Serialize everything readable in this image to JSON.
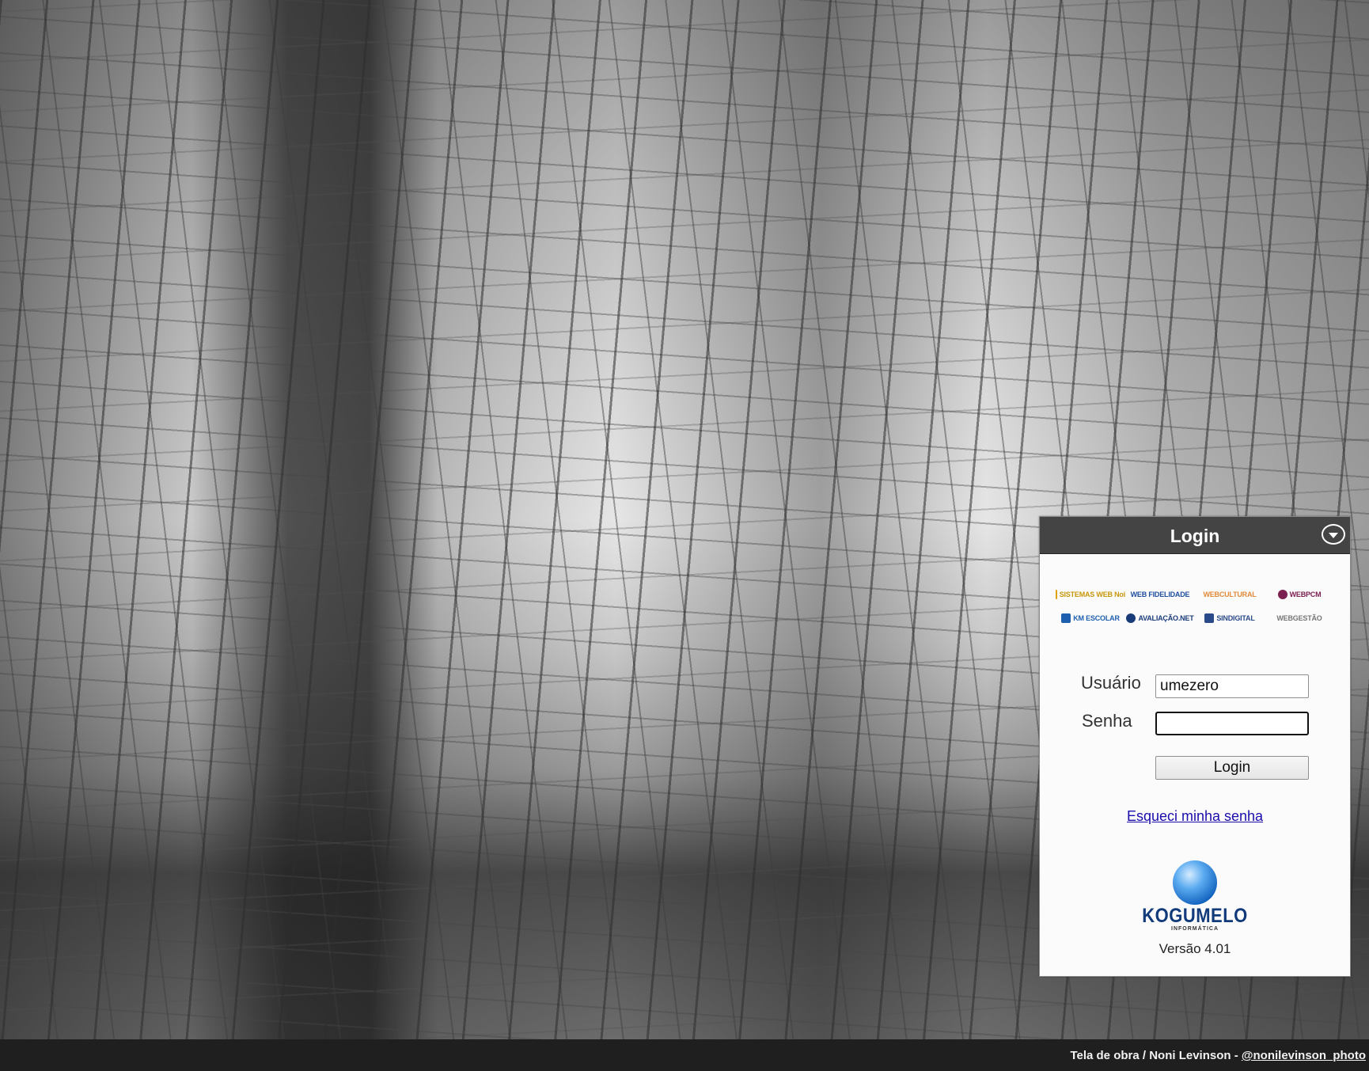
{
  "background": {
    "credit_text": "Tela de obra / Noni Levinson - ",
    "credit_link": "@nonilevinson_photo"
  },
  "panel": {
    "title": "Login",
    "logos": [
      {
        "name": "SISTEMAS WEB Noi",
        "color": "#e0a000"
      },
      {
        "name": "WEB FIDELIDADE",
        "color": "#1f4fa0"
      },
      {
        "name": "WEBCULTURAL",
        "color": "#e08a3a"
      },
      {
        "name": "WEBPCM",
        "color": "#7b2050"
      },
      {
        "name": "KM ESCOLAR",
        "color": "#1f5fb0"
      },
      {
        "name": "AVALIAÇÃO.NET",
        "color": "#1a3b7a"
      },
      {
        "name": "SINDIGITAL",
        "color": "#2b4a8a"
      },
      {
        "name": "WEBGESTÃO",
        "color": "#c05020"
      }
    ],
    "form": {
      "user_label": "Usuário",
      "user_value": "umezero",
      "password_label": "Senha",
      "password_value": "",
      "login_button": "Login"
    },
    "forgot_link": "Esqueci minha senha",
    "brand": {
      "name": "KOGUMELO",
      "sub": "INFORMÁTICA"
    },
    "version": "Versão 4.01"
  }
}
